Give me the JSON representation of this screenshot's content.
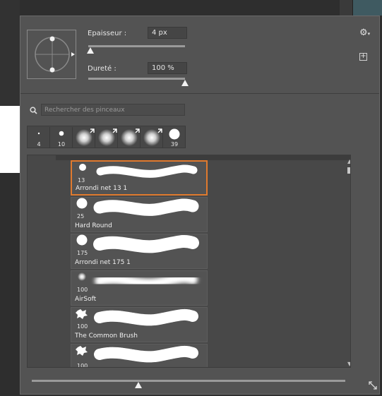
{
  "panel": {
    "size_label": "Epaisseur :",
    "size_value": "4 px",
    "size_level": 0.02,
    "hardness_label": "Dureté :",
    "hardness_value": "100 %",
    "hardness_level": 1.0,
    "settings_icon": "gear-icon",
    "new_preset_icon": "new-preset-icon"
  },
  "search": {
    "placeholder": "Rechercher des pinceaux",
    "value": ""
  },
  "recent_brushes": [
    {
      "size": "4",
      "kind": "hard"
    },
    {
      "size": "10",
      "kind": "hard"
    },
    {
      "size": "",
      "kind": "soft"
    },
    {
      "size": "",
      "kind": "soft"
    },
    {
      "size": "",
      "kind": "soft"
    },
    {
      "size": "",
      "kind": "soft"
    },
    {
      "size": "39",
      "kind": "hard"
    }
  ],
  "brushes": [
    {
      "size": "13",
      "name": "Arrondi net 13 1",
      "selected": true,
      "kind": "hard"
    },
    {
      "size": "25",
      "name": "Hard Round",
      "selected": false,
      "kind": "hard"
    },
    {
      "size": "175",
      "name": "Arrondi net 175 1",
      "selected": false,
      "kind": "hard"
    },
    {
      "size": "100",
      "name": "AirSoft",
      "selected": false,
      "kind": "soft"
    },
    {
      "size": "100",
      "name": "The Common Brush",
      "selected": false,
      "kind": "rough"
    },
    {
      "size": "100",
      "name": "",
      "selected": false,
      "kind": "rough"
    }
  ],
  "zoom_level": 0.34,
  "colors": {
    "selection": "#e07a2e",
    "panel": "#535353"
  }
}
